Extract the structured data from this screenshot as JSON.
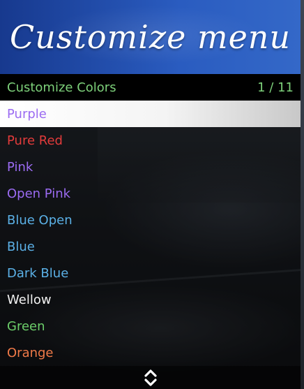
{
  "menu": {
    "banner_title": "Customize menu",
    "subtitle": "Customize Colors",
    "counter": "1 / 11",
    "selected_index": 0,
    "items": [
      {
        "label": "Purple",
        "color": "#9b6bf2"
      },
      {
        "label": "Pure Red",
        "color": "#e23b3b"
      },
      {
        "label": "Pink",
        "color": "#9b6bf2"
      },
      {
        "label": "Open Pink",
        "color": "#9b6bf2"
      },
      {
        "label": "Blue Open",
        "color": "#5bb0e6"
      },
      {
        "label": "Blue",
        "color": "#5bb0e6"
      },
      {
        "label": "Dark Blue",
        "color": "#5bb0e6"
      },
      {
        "label": "Wellow",
        "color": "#f2f2f2"
      },
      {
        "label": "Green",
        "color": "#6cce6a"
      },
      {
        "label": "Orange",
        "color": "#f07a48"
      }
    ],
    "footer_icon": "up-down-arrows-icon"
  },
  "colors": {
    "banner": "#2a5cc0",
    "subtitle_text": "#7dd07a",
    "selected_bg": "#ffffff"
  }
}
